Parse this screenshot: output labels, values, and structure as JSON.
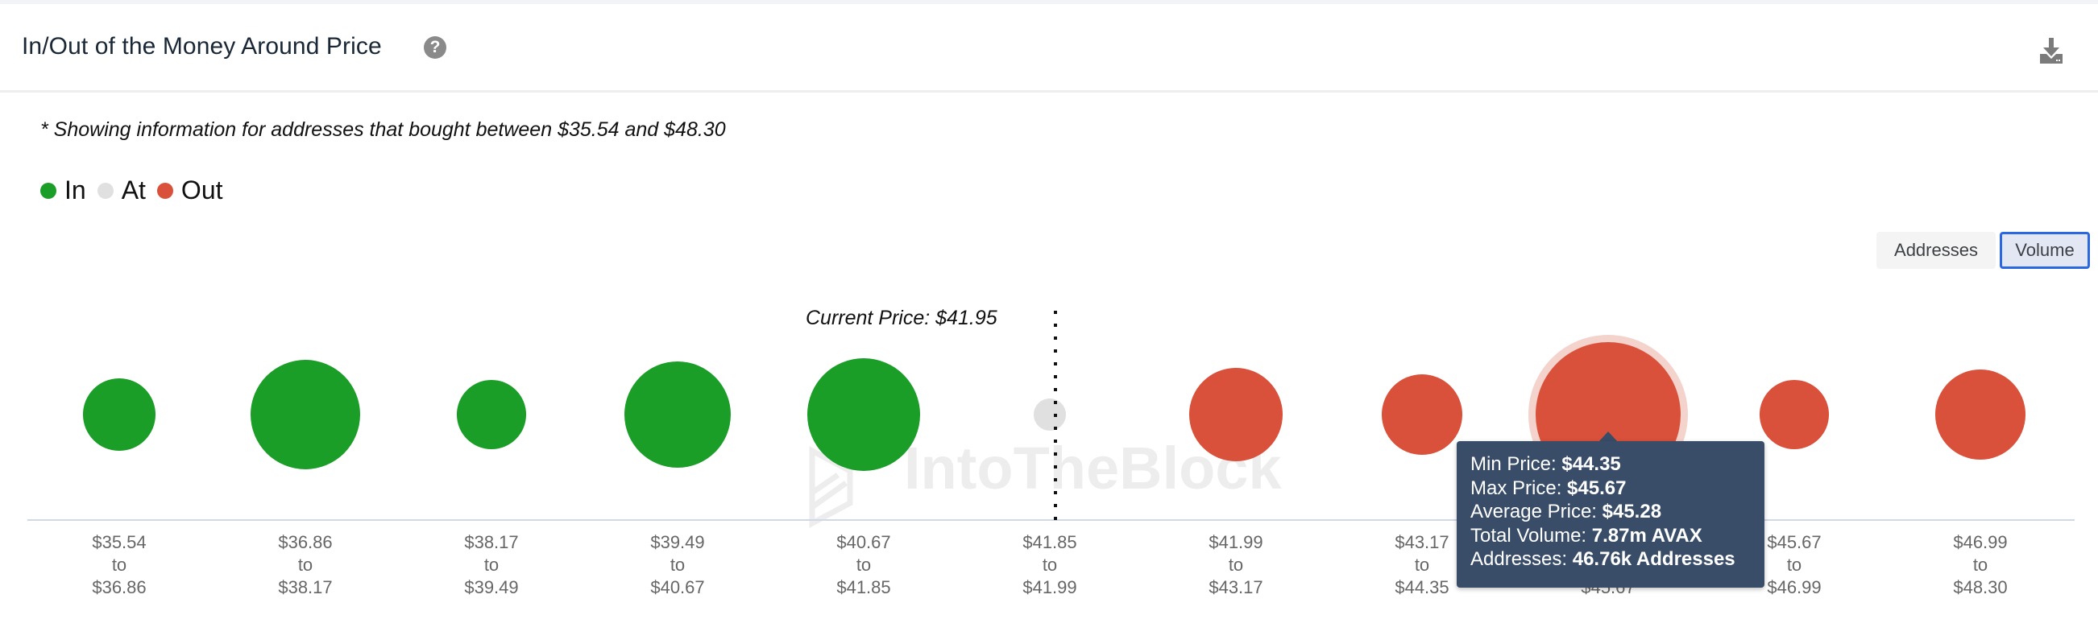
{
  "header": {
    "title": "In/Out of the Money Around Price",
    "help_icon": "question-circle-icon",
    "download_icon": "download-icon"
  },
  "note": "* Showing information for addresses that bought between $35.54 and $48.30",
  "legend": [
    {
      "label": "In",
      "color": "#1a9e27"
    },
    {
      "label": "At",
      "color": "#e0e0e0"
    },
    {
      "label": "Out",
      "color": "#d9513a"
    }
  ],
  "toggle": {
    "options": [
      "Addresses",
      "Volume"
    ],
    "selected": "Volume"
  },
  "watermark": "IntoTheBlock",
  "colors": {
    "in": "#1a9e27",
    "at": "#e0e0e0",
    "out": "#d9513a",
    "halo": "#f5d3cd",
    "axis": "#d0d9e8",
    "tooltip_bg": "#3a4d68",
    "accent": "#2a67e0"
  },
  "chart_data": {
    "type": "bubble",
    "title": "In/Out of the Money Around Price",
    "metric": "Volume (AVAX, millions, estimated from bubble size relative to the 7.87m tooltip value)",
    "current_price": 41.95,
    "current_price_label": "Current Price: $41.95",
    "connector_word": "to",
    "buckets": [
      {
        "from": "$35.54",
        "to": "$36.86",
        "status": "in",
        "volume_m": 1.97
      },
      {
        "from": "$36.86",
        "to": "$38.17",
        "status": "in",
        "volume_m": 4.49
      },
      {
        "from": "$38.17",
        "to": "$39.49",
        "status": "in",
        "volume_m": 1.8
      },
      {
        "from": "$39.49",
        "to": "$40.67",
        "status": "in",
        "volume_m": 4.23
      },
      {
        "from": "$40.67",
        "to": "$41.85",
        "status": "in",
        "volume_m": 4.76
      },
      {
        "from": "$41.85",
        "to": "$41.99",
        "status": "at",
        "volume_m": 0.39
      },
      {
        "from": "$41.99",
        "to": "$43.17",
        "status": "out",
        "volume_m": 3.27
      },
      {
        "from": "$43.17",
        "to": "$44.35",
        "status": "out",
        "volume_m": 2.43
      },
      {
        "from": "$44.35",
        "to": "$45.67",
        "status": "out",
        "volume_m": 7.87,
        "highlighted": true
      },
      {
        "from": "$45.67",
        "to": "$46.99",
        "status": "out",
        "volume_m": 1.8
      },
      {
        "from": "$46.99",
        "to": "$48.30",
        "status": "out",
        "volume_m": 3.05
      }
    ],
    "current_price_position": "between buckets 6 and 7 ($41.85–$41.99)"
  },
  "tooltip": {
    "rows": [
      {
        "label": "Min Price: ",
        "value": "$44.35"
      },
      {
        "label": "Max Price: ",
        "value": "$45.67"
      },
      {
        "label": "Average Price: ",
        "value": "$45.28"
      },
      {
        "label": "Total Volume: ",
        "value": "7.87m AVAX"
      },
      {
        "label": "Addresses: ",
        "value": "46.76k Addresses"
      }
    ]
  }
}
